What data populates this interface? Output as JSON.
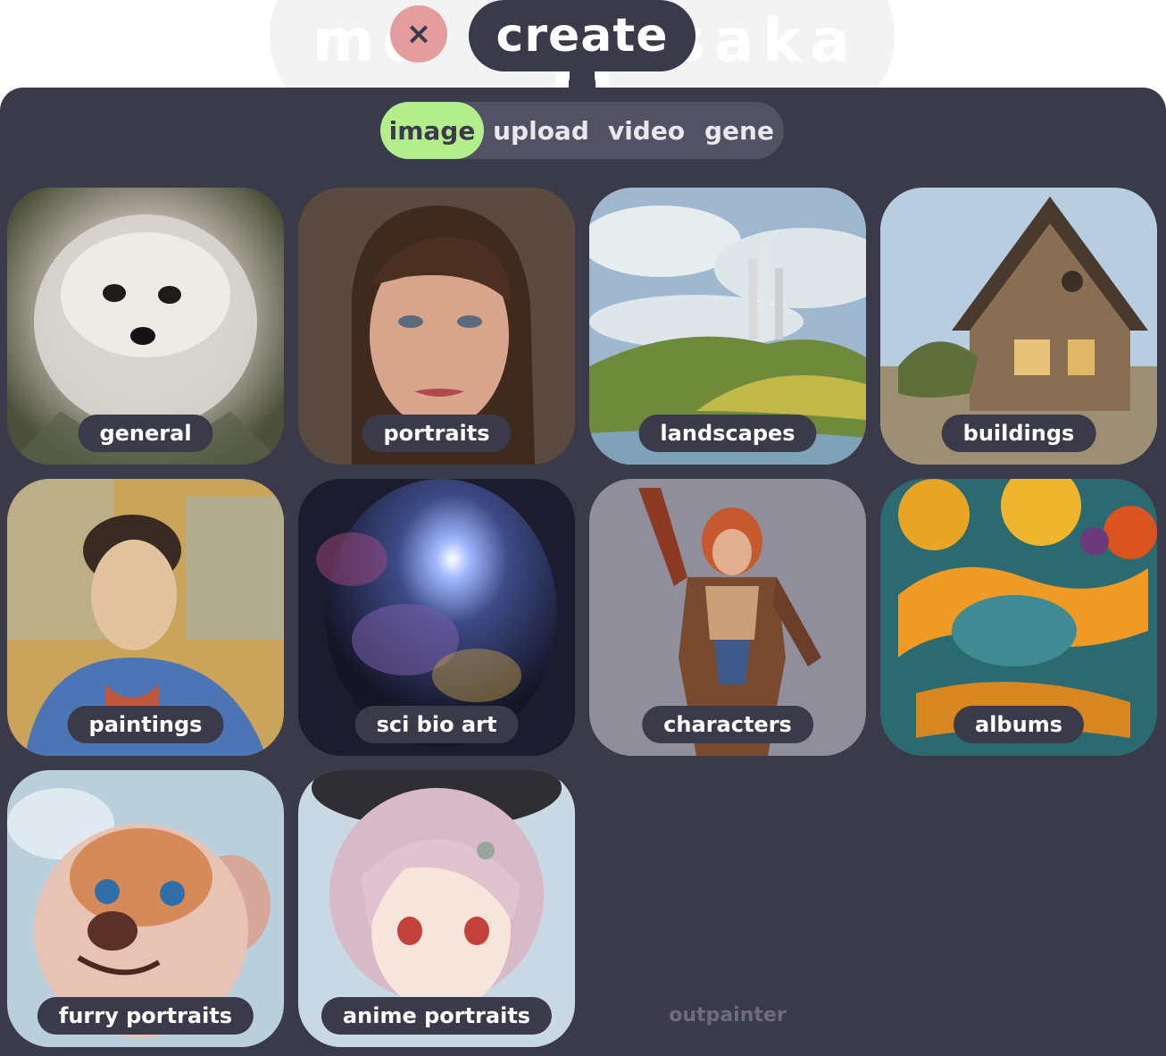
{
  "header": {
    "title": "create",
    "close_label": "×",
    "background_logo": [
      "m",
      "o",
      "s",
      "a",
      "k",
      "a"
    ]
  },
  "mode_tabs": [
    {
      "label": "image",
      "active": true
    },
    {
      "label": "upload",
      "active": false
    },
    {
      "label": "video",
      "active": false
    },
    {
      "label": "gene",
      "active": false
    }
  ],
  "categories": [
    {
      "label": "general",
      "art": "fluffy-dog"
    },
    {
      "label": "portraits",
      "art": "woman-portrait"
    },
    {
      "label": "landscapes",
      "art": "castle-landscape"
    },
    {
      "label": "buildings",
      "art": "cottage"
    },
    {
      "label": "paintings",
      "art": "impressionist-woman"
    },
    {
      "label": "sci bio art",
      "art": "nebula"
    },
    {
      "label": "characters",
      "art": "armored-warrior"
    },
    {
      "label": "albums",
      "art": "psychedelic-album"
    },
    {
      "label": "furry portraits",
      "art": "furry-bear"
    },
    {
      "label": "anime portraits",
      "art": "anime-girl"
    }
  ],
  "outpainter_label": "outpainter",
  "colors": {
    "panel": "#3b3a4b",
    "active_tab": "#b4ee8c",
    "close_button": "#e59c9c"
  }
}
